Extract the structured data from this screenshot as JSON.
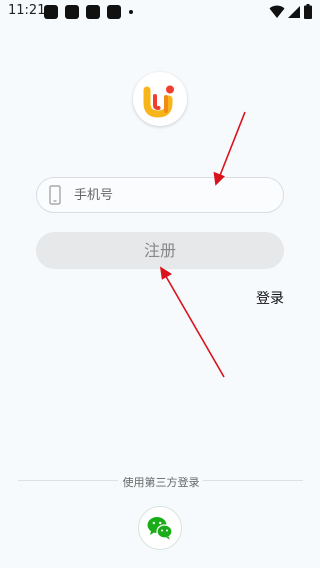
{
  "status_bar": {
    "time": "11:21"
  },
  "logo": {
    "icon": "app-logo"
  },
  "phone_input": {
    "placeholder": "手机号",
    "value": ""
  },
  "register_button": {
    "label": "注册"
  },
  "login_link": {
    "label": "登录"
  },
  "third_party": {
    "label": "使用第三方登录",
    "providers": [
      "wechat-icon"
    ]
  },
  "colors": {
    "background": "#f7fafd",
    "button_bg": "#e7e8e9",
    "button_text": "#888888",
    "wechat_green": "#1aad19",
    "annotation_red": "#d9121b"
  }
}
